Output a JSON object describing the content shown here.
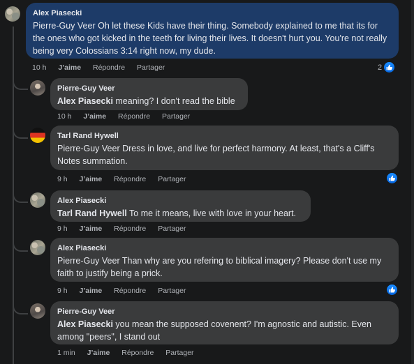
{
  "comments": [
    {
      "author": "Alex Piasecki",
      "text": "Pierre-Guy Veer Oh let these Kids have their thing. Somebody explained to me that its for the ones who got kicked in the teeth for living their lives. It doesn't hurt you. You're not really being very Colossians 3:14 right now, my dude.",
      "time": "10 h",
      "reaction_count": "2"
    },
    {
      "author": "Pierre-Guy Veer",
      "mention": "Alex Piasecki",
      "text": " meaning? I don't read the bible",
      "time": "10 h"
    },
    {
      "author": "Tarl Rand Hywell",
      "text": "Pierre-Guy Veer Dress in love, and live for perfect harmony. At least, that's a Cliff's Notes summation.",
      "time": "9 h"
    },
    {
      "author": "Alex Piasecki",
      "mention": "Tarl Rand Hywell",
      "text": " To me it means, live with love in your heart.",
      "time": "9 h"
    },
    {
      "author": "Alex Piasecki",
      "text": "Pierre-Guy Veer Than why are you refering to biblical imagery? Please don't use my faith to justify being a prick.",
      "time": "9 h"
    },
    {
      "author": "Pierre-Guy Veer",
      "mention": "Alex Piasecki",
      "text": " you mean the supposed covenent? I'm agnostic and autistic. Even among \"peers\", I stand out",
      "time": "1 min"
    }
  ],
  "actions": {
    "like": "J’aime",
    "reply": "Répondre",
    "share": "Partager"
  },
  "icons": {
    "like_badge": "thumbs-up-icon"
  },
  "colors": {
    "main_bubble": "#1d3b68",
    "reply_bubble": "#3a3b3c",
    "like_blue": "#1877f2"
  }
}
